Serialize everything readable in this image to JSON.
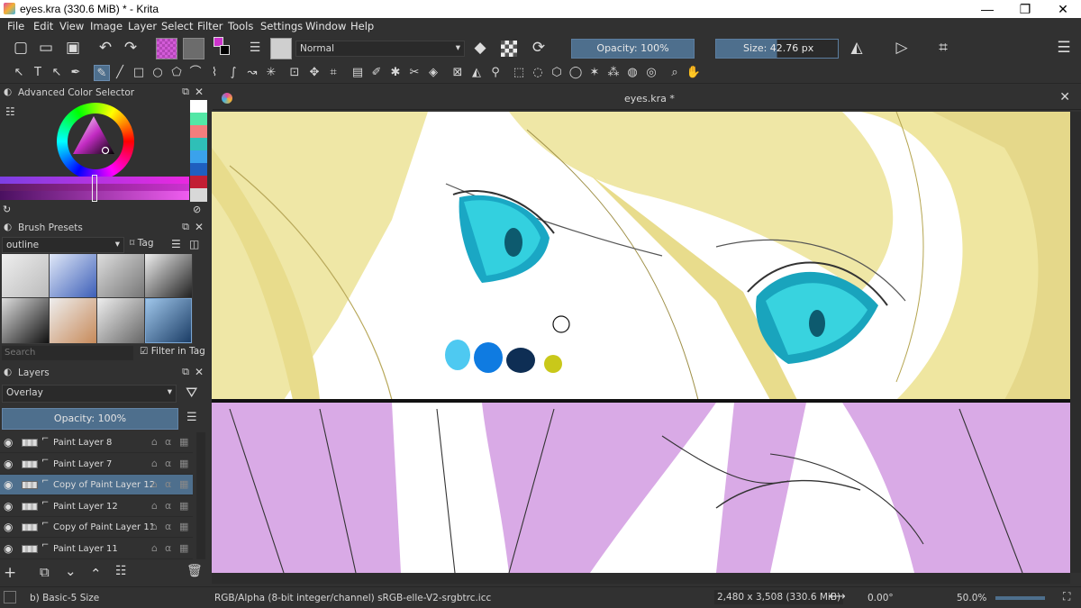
{
  "window": {
    "title": "eyes.kra (330.6 MiB)  * - Krita",
    "min": "—",
    "max": "❐",
    "close": "✕"
  },
  "menu": [
    "File",
    "Edit",
    "View",
    "Image",
    "Layer",
    "Select",
    "Filter",
    "Tools",
    "Settings",
    "Window",
    "Help"
  ],
  "toolbar": {
    "blend_mode": "Normal",
    "opacity_label": "Opacity: 100%",
    "size_label": "Size: 42.76 px"
  },
  "color_selector": {
    "title": "Advanced Color Selector",
    "swatches": [
      "#ffffff",
      "#53e7a6",
      "#f37d7d",
      "#2fbfb7",
      "#3aa2ec",
      "#1f5fbf",
      "#c21e34",
      "#d8d8d8"
    ]
  },
  "brush_presets": {
    "title": "Brush Presets",
    "tag_select": "outline",
    "tag_button": "Tag",
    "search_placeholder": "Search",
    "filter_in_tag": "Filter in Tag"
  },
  "layers": {
    "title": "Layers",
    "blend_mode": "Overlay",
    "opacity_label": "Opacity:  100%",
    "items": [
      {
        "name": "Paint Layer 8",
        "selected": false
      },
      {
        "name": "Paint Layer 7",
        "selected": false
      },
      {
        "name": "Copy of Paint Layer 12",
        "selected": true
      },
      {
        "name": "Paint Layer 12",
        "selected": false
      },
      {
        "name": "Copy of Paint Layer 11",
        "selected": false
      },
      {
        "name": "Paint Layer 11",
        "selected": false
      }
    ]
  },
  "canvas": {
    "tab_title": "eyes.kra *",
    "palette": [
      "#4ec9f1",
      "#0f7be1",
      "#0e2e54",
      "#c9c81a"
    ]
  },
  "status": {
    "brush": "b) Basic-5 Size",
    "color_space": "RGB/Alpha (8-bit integer/channel)  sRGB-elle-V2-srgbtrc.icc",
    "dimensions": "2,480 x 3,508 (330.6 MiB)",
    "rotation": "0.00°",
    "zoom": "50.0%"
  }
}
